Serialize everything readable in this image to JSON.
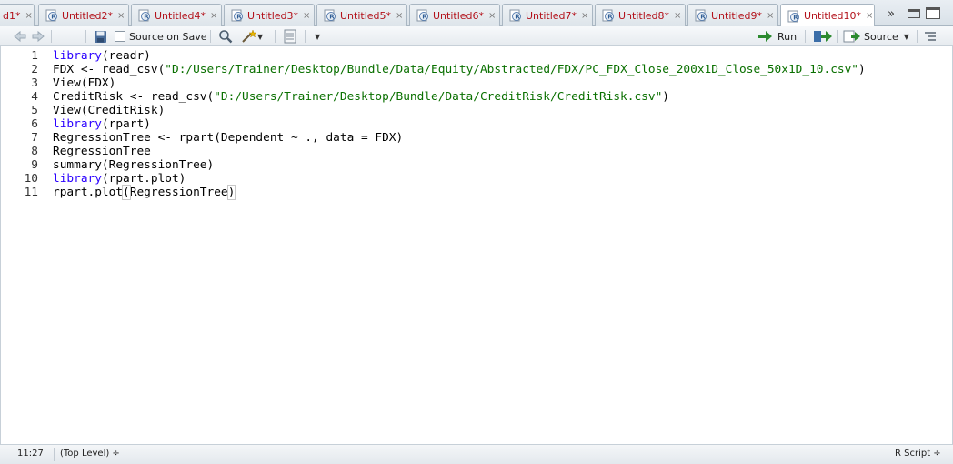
{
  "tabs": [
    {
      "label": "d1*",
      "active": false
    },
    {
      "label": "Untitled2*",
      "active": false
    },
    {
      "label": "Untitled4*",
      "active": false
    },
    {
      "label": "Untitled3*",
      "active": false
    },
    {
      "label": "Untitled5*",
      "active": false
    },
    {
      "label": "Untitled6*",
      "active": false
    },
    {
      "label": "Untitled7*",
      "active": false
    },
    {
      "label": "Untitled8*",
      "active": false
    },
    {
      "label": "Untitled9*",
      "active": false
    },
    {
      "label": "Untitled10*",
      "active": true
    }
  ],
  "tab_close_glyph": "×",
  "tab_overflow_glyph": "»",
  "toolbar": {
    "source_on_save_label": "Source on Save",
    "run_label": "Run",
    "source_label": "Source",
    "icons": [
      "back-arrow-icon",
      "forward-arrow-icon",
      "save-icon",
      "search-icon",
      "magic-wand-icon",
      "compile-report-icon",
      "run-arrow-icon",
      "re-run-icon",
      "source-icon",
      "outline-icon"
    ]
  },
  "editor": {
    "line_numbers": [
      "1",
      "2",
      "3",
      "4",
      "5",
      "6",
      "7",
      "8",
      "9",
      "10",
      "11"
    ],
    "lines": [
      [
        {
          "t": "library",
          "c": "kw"
        },
        {
          "t": "(readr)",
          "c": ""
        }
      ],
      [
        {
          "t": "FDX <- read_csv(",
          "c": ""
        },
        {
          "t": "\"D:/Users/Trainer/Desktop/Bundle/Data/Equity/Abstracted/FDX/PC_FDX_Close_200x1D_Close_50x1D_10.csv\"",
          "c": "str"
        },
        {
          "t": ")",
          "c": ""
        }
      ],
      [
        {
          "t": "View(FDX)",
          "c": ""
        }
      ],
      [
        {
          "t": "CreditRisk <- read_csv(",
          "c": ""
        },
        {
          "t": "\"D:/Users/Trainer/Desktop/Bundle/Data/CreditRisk/CreditRisk.csv\"",
          "c": "str"
        },
        {
          "t": ")",
          "c": ""
        }
      ],
      [
        {
          "t": "View(CreditRisk)",
          "c": ""
        }
      ],
      [
        {
          "t": "library",
          "c": "kw"
        },
        {
          "t": "(rpart)",
          "c": ""
        }
      ],
      [
        {
          "t": "RegressionTree <- rpart(Dependent ~ ., data = FDX)",
          "c": ""
        }
      ],
      [
        {
          "t": "RegressionTree",
          "c": ""
        }
      ],
      [
        {
          "t": "summary(RegressionTree)",
          "c": ""
        }
      ],
      [
        {
          "t": "library",
          "c": "kw"
        },
        {
          "t": "(rpart.plot)",
          "c": ""
        }
      ],
      [
        {
          "t": "rpart.plot",
          "c": ""
        },
        {
          "t": "(",
          "c": "paren-match"
        },
        {
          "t": "RegressionTree",
          "c": ""
        },
        {
          "t": ")",
          "c": "paren-match"
        }
      ]
    ]
  },
  "status": {
    "position": "11:27",
    "scope": "(Top Level) ÷",
    "file_type": "R Script ÷"
  },
  "colors": {
    "tab_text": "#b3121b",
    "keyword": "#2a00ff",
    "string": "#0a7000"
  }
}
